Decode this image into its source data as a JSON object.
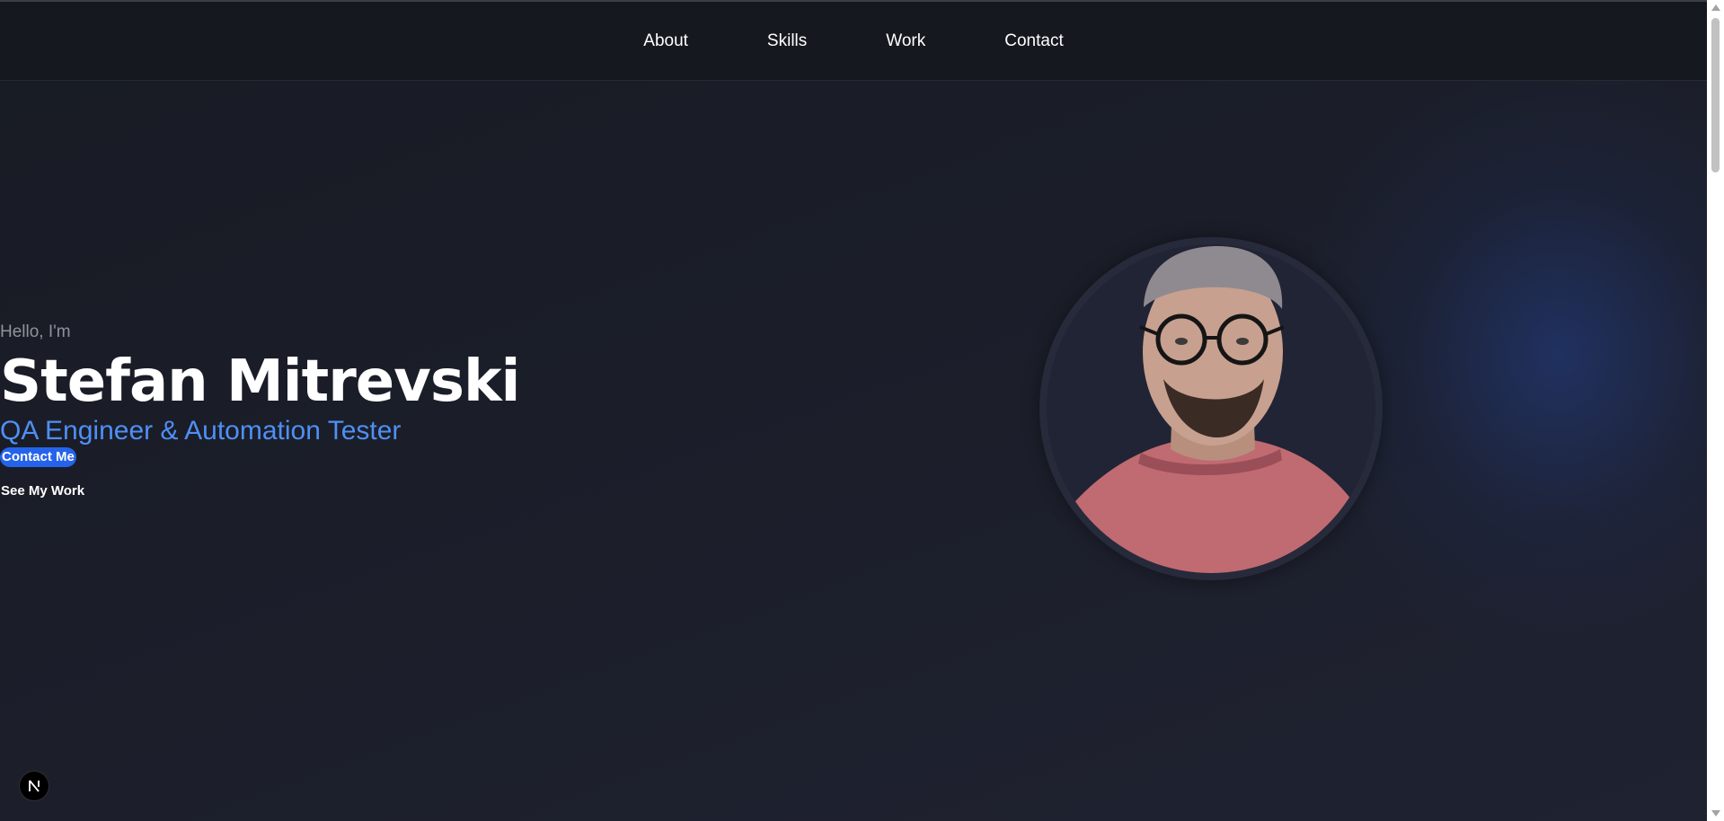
{
  "nav": {
    "items": [
      {
        "label": "About"
      },
      {
        "label": "Skills"
      },
      {
        "label": "Work"
      },
      {
        "label": "Contact"
      }
    ]
  },
  "hero": {
    "greeting": "Hello, I'm",
    "name": "Stefan Mitrevski",
    "role": "QA Engineer & Automation Tester",
    "primary_button": "Contact Me",
    "secondary_button": "See My Work"
  },
  "colors": {
    "background": "#1a1d27",
    "navbar": "#15181f",
    "accent": "#4f8ff5",
    "button": "#2563eb"
  },
  "icons": {
    "dev_badge": "nextjs-icon"
  }
}
